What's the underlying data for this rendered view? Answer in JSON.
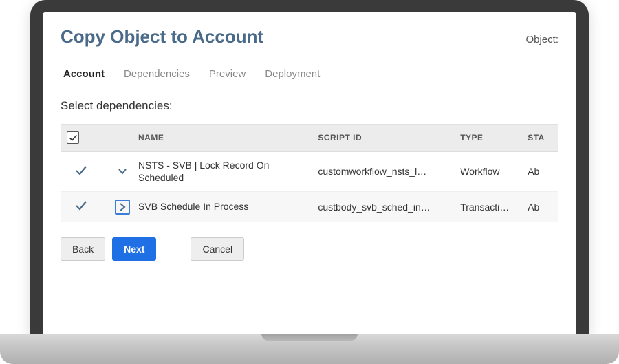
{
  "header": {
    "title": "Copy Object to Account",
    "object_label": "Object:"
  },
  "tabs": [
    {
      "label": "Account",
      "active": false
    },
    {
      "label": "Dependencies",
      "active": true
    },
    {
      "label": "Preview",
      "active": false
    },
    {
      "label": "Deployment",
      "active": false
    }
  ],
  "section_label": "Select dependencies:",
  "table": {
    "columns": {
      "name": "NAME",
      "script_id": "SCRIPT ID",
      "type": "TYPE",
      "status": "STA"
    },
    "rows": [
      {
        "checked": true,
        "expand_style": "chevron-down",
        "name": "NSTS - SVB | Lock Record On Scheduled",
        "script_id": "customworkflow_nsts_l…",
        "type": "Workflow",
        "status": "Ab"
      },
      {
        "checked": true,
        "expand_style": "boxed-right",
        "name": "SVB Schedule In Process",
        "script_id": "custbody_svb_sched_in…",
        "type": "Transacti…",
        "status": "Ab"
      }
    ]
  },
  "buttons": {
    "back": "Back",
    "next": "Next",
    "cancel": "Cancel"
  }
}
